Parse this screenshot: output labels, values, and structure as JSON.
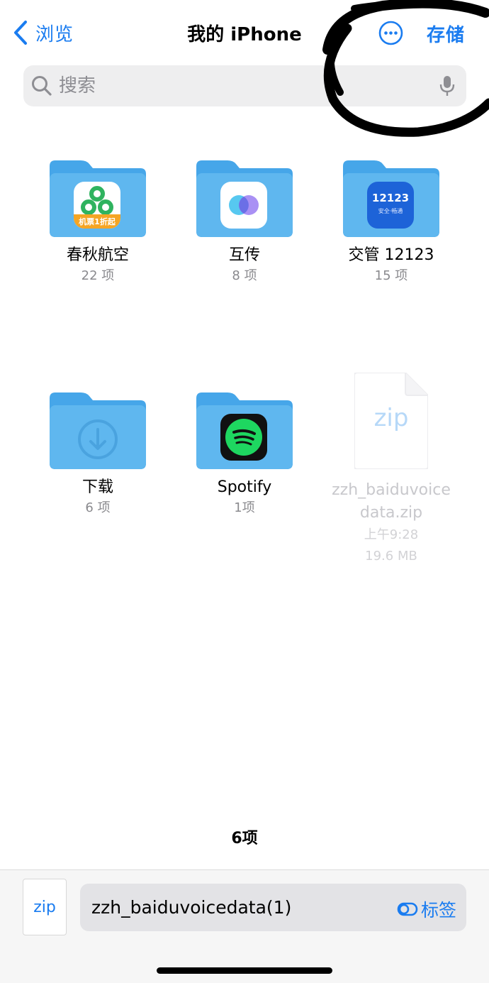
{
  "nav": {
    "back_label": "浏览",
    "title": "我的 iPhone",
    "save_label": "存储"
  },
  "search": {
    "placeholder": "搜索"
  },
  "items": [
    {
      "name": "春秋航空",
      "meta": "22 项",
      "icon": "spring-airlines-app-icon"
    },
    {
      "name": "互传",
      "meta": "8 项",
      "icon": "hutransfer-app-icon"
    },
    {
      "name": "交管 12123",
      "meta": "15 项",
      "icon": "traffic-12123-app-icon"
    },
    {
      "name": "下载",
      "meta": "6 项",
      "icon": "download-icon"
    },
    {
      "name": "Spotify",
      "meta": "1项",
      "icon": "spotify-app-icon"
    },
    {
      "name": "zzh_baiduvoicedata.zip",
      "date": "上午9:28",
      "size": "19.6 MB",
      "icon_label": "zip"
    }
  ],
  "app_badges": {
    "spring_text": "机票1折起",
    "traffic_number": "12123",
    "traffic_sub": "安全·畅通"
  },
  "summary": {
    "count": "6项"
  },
  "bottom": {
    "thumb_label": "zip",
    "filename": "zzh_baiduvoicedata(1)",
    "tags_label": "标签"
  },
  "colors": {
    "accent": "#1a7cf0",
    "folder": "#5fb7ef",
    "folder_tab": "#46a6e9"
  }
}
